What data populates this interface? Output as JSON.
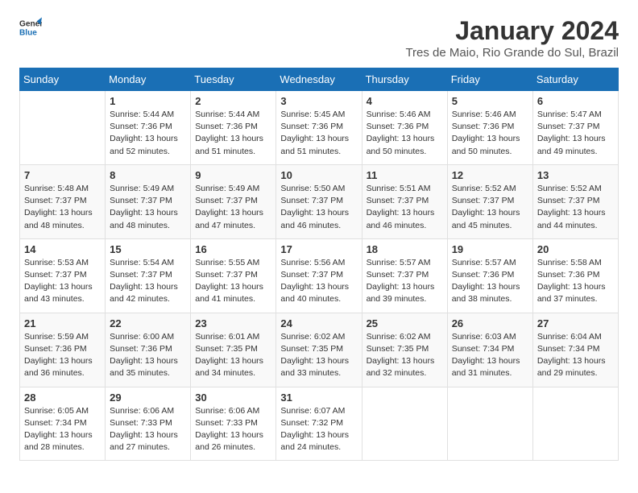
{
  "logo": {
    "line1": "General",
    "line2": "Blue"
  },
  "title": "January 2024",
  "subtitle": "Tres de Maio, Rio Grande do Sul, Brazil",
  "headers": [
    "Sunday",
    "Monday",
    "Tuesday",
    "Wednesday",
    "Thursday",
    "Friday",
    "Saturday"
  ],
  "weeks": [
    [
      {
        "day": "",
        "info": ""
      },
      {
        "day": "1",
        "info": "Sunrise: 5:44 AM\nSunset: 7:36 PM\nDaylight: 13 hours\nand 52 minutes."
      },
      {
        "day": "2",
        "info": "Sunrise: 5:44 AM\nSunset: 7:36 PM\nDaylight: 13 hours\nand 51 minutes."
      },
      {
        "day": "3",
        "info": "Sunrise: 5:45 AM\nSunset: 7:36 PM\nDaylight: 13 hours\nand 51 minutes."
      },
      {
        "day": "4",
        "info": "Sunrise: 5:46 AM\nSunset: 7:36 PM\nDaylight: 13 hours\nand 50 minutes."
      },
      {
        "day": "5",
        "info": "Sunrise: 5:46 AM\nSunset: 7:36 PM\nDaylight: 13 hours\nand 50 minutes."
      },
      {
        "day": "6",
        "info": "Sunrise: 5:47 AM\nSunset: 7:37 PM\nDaylight: 13 hours\nand 49 minutes."
      }
    ],
    [
      {
        "day": "7",
        "info": "Sunrise: 5:48 AM\nSunset: 7:37 PM\nDaylight: 13 hours\nand 48 minutes."
      },
      {
        "day": "8",
        "info": "Sunrise: 5:49 AM\nSunset: 7:37 PM\nDaylight: 13 hours\nand 48 minutes."
      },
      {
        "day": "9",
        "info": "Sunrise: 5:49 AM\nSunset: 7:37 PM\nDaylight: 13 hours\nand 47 minutes."
      },
      {
        "day": "10",
        "info": "Sunrise: 5:50 AM\nSunset: 7:37 PM\nDaylight: 13 hours\nand 46 minutes."
      },
      {
        "day": "11",
        "info": "Sunrise: 5:51 AM\nSunset: 7:37 PM\nDaylight: 13 hours\nand 46 minutes."
      },
      {
        "day": "12",
        "info": "Sunrise: 5:52 AM\nSunset: 7:37 PM\nDaylight: 13 hours\nand 45 minutes."
      },
      {
        "day": "13",
        "info": "Sunrise: 5:52 AM\nSunset: 7:37 PM\nDaylight: 13 hours\nand 44 minutes."
      }
    ],
    [
      {
        "day": "14",
        "info": "Sunrise: 5:53 AM\nSunset: 7:37 PM\nDaylight: 13 hours\nand 43 minutes."
      },
      {
        "day": "15",
        "info": "Sunrise: 5:54 AM\nSunset: 7:37 PM\nDaylight: 13 hours\nand 42 minutes."
      },
      {
        "day": "16",
        "info": "Sunrise: 5:55 AM\nSunset: 7:37 PM\nDaylight: 13 hours\nand 41 minutes."
      },
      {
        "day": "17",
        "info": "Sunrise: 5:56 AM\nSunset: 7:37 PM\nDaylight: 13 hours\nand 40 minutes."
      },
      {
        "day": "18",
        "info": "Sunrise: 5:57 AM\nSunset: 7:37 PM\nDaylight: 13 hours\nand 39 minutes."
      },
      {
        "day": "19",
        "info": "Sunrise: 5:57 AM\nSunset: 7:36 PM\nDaylight: 13 hours\nand 38 minutes."
      },
      {
        "day": "20",
        "info": "Sunrise: 5:58 AM\nSunset: 7:36 PM\nDaylight: 13 hours\nand 37 minutes."
      }
    ],
    [
      {
        "day": "21",
        "info": "Sunrise: 5:59 AM\nSunset: 7:36 PM\nDaylight: 13 hours\nand 36 minutes."
      },
      {
        "day": "22",
        "info": "Sunrise: 6:00 AM\nSunset: 7:36 PM\nDaylight: 13 hours\nand 35 minutes."
      },
      {
        "day": "23",
        "info": "Sunrise: 6:01 AM\nSunset: 7:35 PM\nDaylight: 13 hours\nand 34 minutes."
      },
      {
        "day": "24",
        "info": "Sunrise: 6:02 AM\nSunset: 7:35 PM\nDaylight: 13 hours\nand 33 minutes."
      },
      {
        "day": "25",
        "info": "Sunrise: 6:02 AM\nSunset: 7:35 PM\nDaylight: 13 hours\nand 32 minutes."
      },
      {
        "day": "26",
        "info": "Sunrise: 6:03 AM\nSunset: 7:34 PM\nDaylight: 13 hours\nand 31 minutes."
      },
      {
        "day": "27",
        "info": "Sunrise: 6:04 AM\nSunset: 7:34 PM\nDaylight: 13 hours\nand 29 minutes."
      }
    ],
    [
      {
        "day": "28",
        "info": "Sunrise: 6:05 AM\nSunset: 7:34 PM\nDaylight: 13 hours\nand 28 minutes."
      },
      {
        "day": "29",
        "info": "Sunrise: 6:06 AM\nSunset: 7:33 PM\nDaylight: 13 hours\nand 27 minutes."
      },
      {
        "day": "30",
        "info": "Sunrise: 6:06 AM\nSunset: 7:33 PM\nDaylight: 13 hours\nand 26 minutes."
      },
      {
        "day": "31",
        "info": "Sunrise: 6:07 AM\nSunset: 7:32 PM\nDaylight: 13 hours\nand 24 minutes."
      },
      {
        "day": "",
        "info": ""
      },
      {
        "day": "",
        "info": ""
      },
      {
        "day": "",
        "info": ""
      }
    ]
  ]
}
